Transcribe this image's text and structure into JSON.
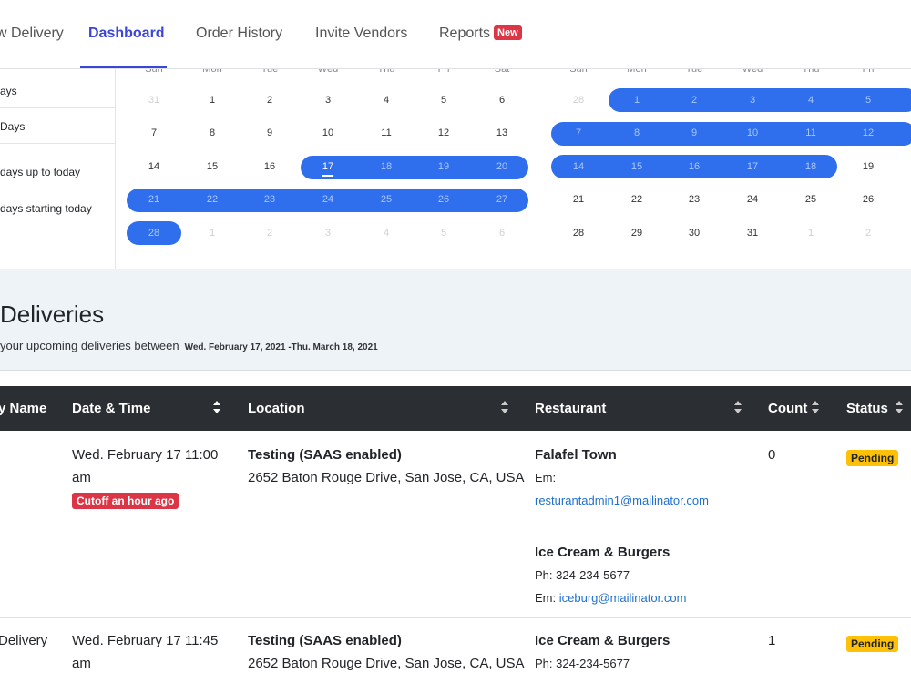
{
  "nav": {
    "items": [
      {
        "label": "w Delivery"
      },
      {
        "label": "Dashboard"
      },
      {
        "label": "Order History"
      },
      {
        "label": "Invite Vendors"
      },
      {
        "label": "Reports"
      }
    ],
    "reports_badge": "New"
  },
  "presets": [
    "ays",
    "Days",
    "days up to today",
    "days starting today"
  ],
  "calendar": {
    "weekdays": [
      "Sun",
      "Mon",
      "Tue",
      "Wed",
      "Thu",
      "Fri",
      "Sat"
    ],
    "left_weeks": [
      [
        "31",
        "1",
        "2",
        "3",
        "4",
        "5",
        "6"
      ],
      [
        "7",
        "8",
        "9",
        "10",
        "11",
        "12",
        "13"
      ],
      [
        "14",
        "15",
        "16",
        "17",
        "18",
        "19",
        "20"
      ],
      [
        "21",
        "22",
        "23",
        "24",
        "25",
        "26",
        "27"
      ],
      [
        "28",
        "1",
        "2",
        "3",
        "4",
        "5",
        "6"
      ]
    ],
    "right_weeks": [
      [
        "28",
        "1",
        "2",
        "3",
        "4",
        "5"
      ],
      [
        "7",
        "8",
        "9",
        "10",
        "11",
        "12"
      ],
      [
        "14",
        "15",
        "16",
        "17",
        "18",
        "19"
      ],
      [
        "21",
        "22",
        "23",
        "24",
        "25",
        "26"
      ],
      [
        "28",
        "29",
        "30",
        "31",
        "1",
        "2"
      ]
    ],
    "right_weekdays": [
      "Sun",
      "Mon",
      "Tue",
      "Wed",
      "Thu",
      "Fri"
    ]
  },
  "deliveries": {
    "title": "Deliveries",
    "subtitle": "your upcoming deliveries between",
    "range": "Wed. February 17, 2021 -Thu. March 18, 2021"
  },
  "table": {
    "headers": [
      "y Name",
      "Date & Time",
      "Location",
      "Restaurant",
      "Count",
      "Status"
    ],
    "rows": [
      {
        "name": "",
        "date": "Wed. February 17 11:00",
        "date2": "am",
        "cutoff": "Cutoff an hour ago",
        "location_title": "Testing (SAAS enabled)",
        "location_addr": "2652 Baton Rouge Drive, San Jose, CA, USA",
        "restaurants": [
          {
            "name": "Falafel Town",
            "phone": "",
            "email_label": "Em:",
            "email": "resturantadmin1@mailinator.com"
          },
          {
            "name": "Ice Cream & Burgers",
            "phone": "Ph: 324-234-5677",
            "email_label": "Em:",
            "email": "iceburg@mailinator.com"
          }
        ],
        "count": "0",
        "status": "Pending"
      },
      {
        "name": "Delivery",
        "date": "Wed. February 17 11:45",
        "date2": "am",
        "location_title": "Testing (SAAS enabled)",
        "location_addr": "2652 Baton Rouge Drive, San Jose, CA, USA",
        "restaurants": [
          {
            "name": "Ice Cream & Burgers",
            "phone": "Ph: 324-234-5677"
          }
        ],
        "count": "1",
        "status": "Pending"
      }
    ]
  },
  "colors": {
    "accent": "#3b46d6",
    "range": "#2f6fed",
    "header_bg": "#2b2f33",
    "danger": "#dc3545",
    "warning": "#ffc107"
  }
}
